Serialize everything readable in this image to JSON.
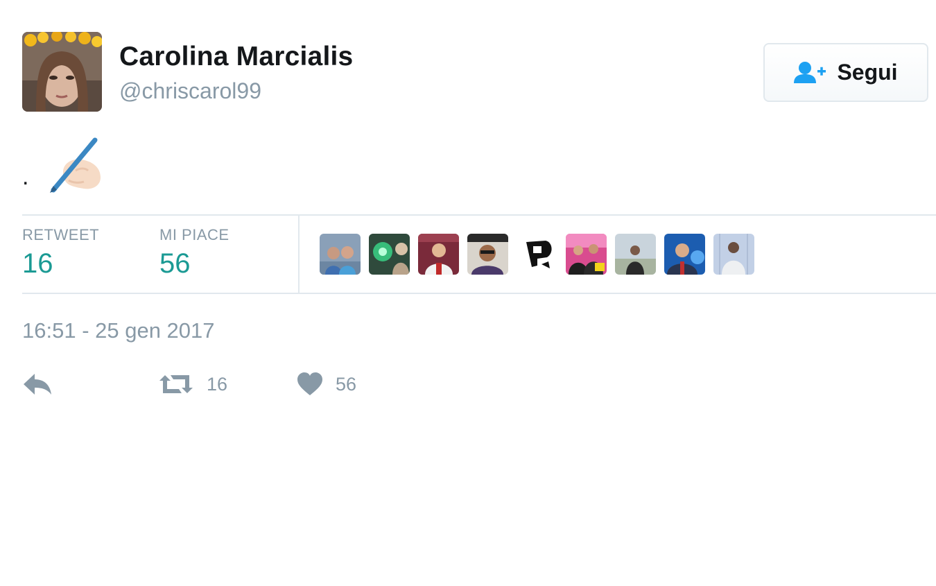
{
  "user": {
    "display_name": "Carolina Marcialis",
    "handle": "@chriscarol99",
    "avatar_icon": "profile-photo"
  },
  "follow_button": {
    "label": "Segui",
    "icon": "follow-icon"
  },
  "tweet": {
    "text": ".",
    "emoji": "writing-hand-emoji"
  },
  "stats": {
    "retweets": {
      "label": "RETWEET",
      "value": "16"
    },
    "likes": {
      "label": "MI PIACE",
      "value": "56"
    }
  },
  "likers_count_shown": 9,
  "timestamp": "16:51 - 25 gen 2017",
  "actions": {
    "reply": {
      "icon": "reply-icon"
    },
    "retweet": {
      "icon": "retweet-icon",
      "count": "16"
    },
    "like": {
      "icon": "heart-icon",
      "count": "56"
    }
  },
  "colors": {
    "accent": "#1b9a94",
    "muted": "#8899a6",
    "border": "#e1e8ed",
    "follow_icon": "#1da1f2"
  }
}
